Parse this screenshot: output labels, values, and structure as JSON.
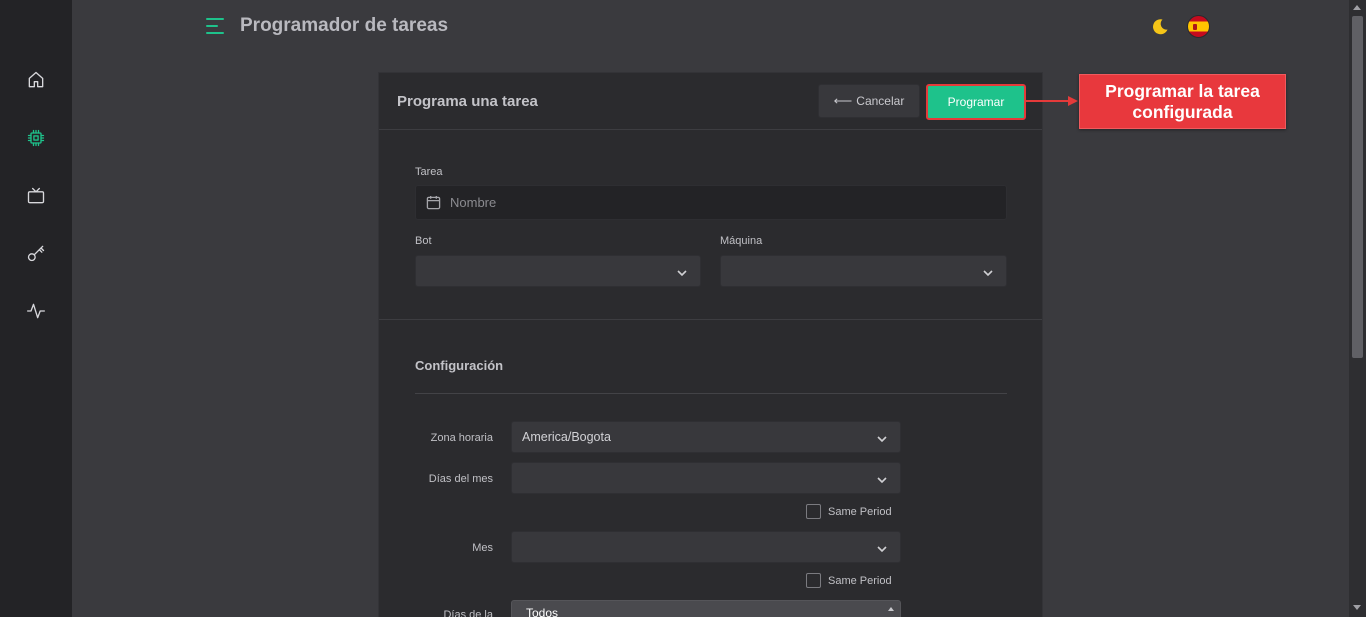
{
  "header": {
    "title": "Programador de tareas",
    "language": "Español"
  },
  "sidebar": {
    "items": [
      {
        "name": "home",
        "icon": "home-icon"
      },
      {
        "name": "processor",
        "icon": "cpu-icon",
        "active": true
      },
      {
        "name": "tv",
        "icon": "tv-icon"
      },
      {
        "name": "keys",
        "icon": "key-icon"
      },
      {
        "name": "activity",
        "icon": "activity-icon"
      }
    ]
  },
  "card": {
    "title": "Programa una tarea",
    "cancel_label": "Cancelar",
    "program_label": "Programar",
    "task": {
      "label": "Tarea",
      "placeholder": "Nombre",
      "value": ""
    },
    "bot": {
      "label": "Bot",
      "value": ""
    },
    "machine": {
      "label": "Máquina",
      "value": ""
    },
    "config": {
      "title": "Configuración",
      "timezone": {
        "label": "Zona horaria",
        "value": "America/Bogota"
      },
      "days_of_month": {
        "label": "Días del mes",
        "value": "",
        "same_period_label": "Same Period"
      },
      "month": {
        "label": "Mes",
        "value": "",
        "same_period_label": "Same Period"
      },
      "days_of_week": {
        "label": "Días de la",
        "first_option": "Todos"
      }
    }
  },
  "annotation": {
    "text": "Programar la tarea configurada"
  },
  "colors": {
    "accent": "#1ec28b",
    "annotation": "#e8383d",
    "background": "#3a3a3e",
    "sidebar": "#232326"
  }
}
